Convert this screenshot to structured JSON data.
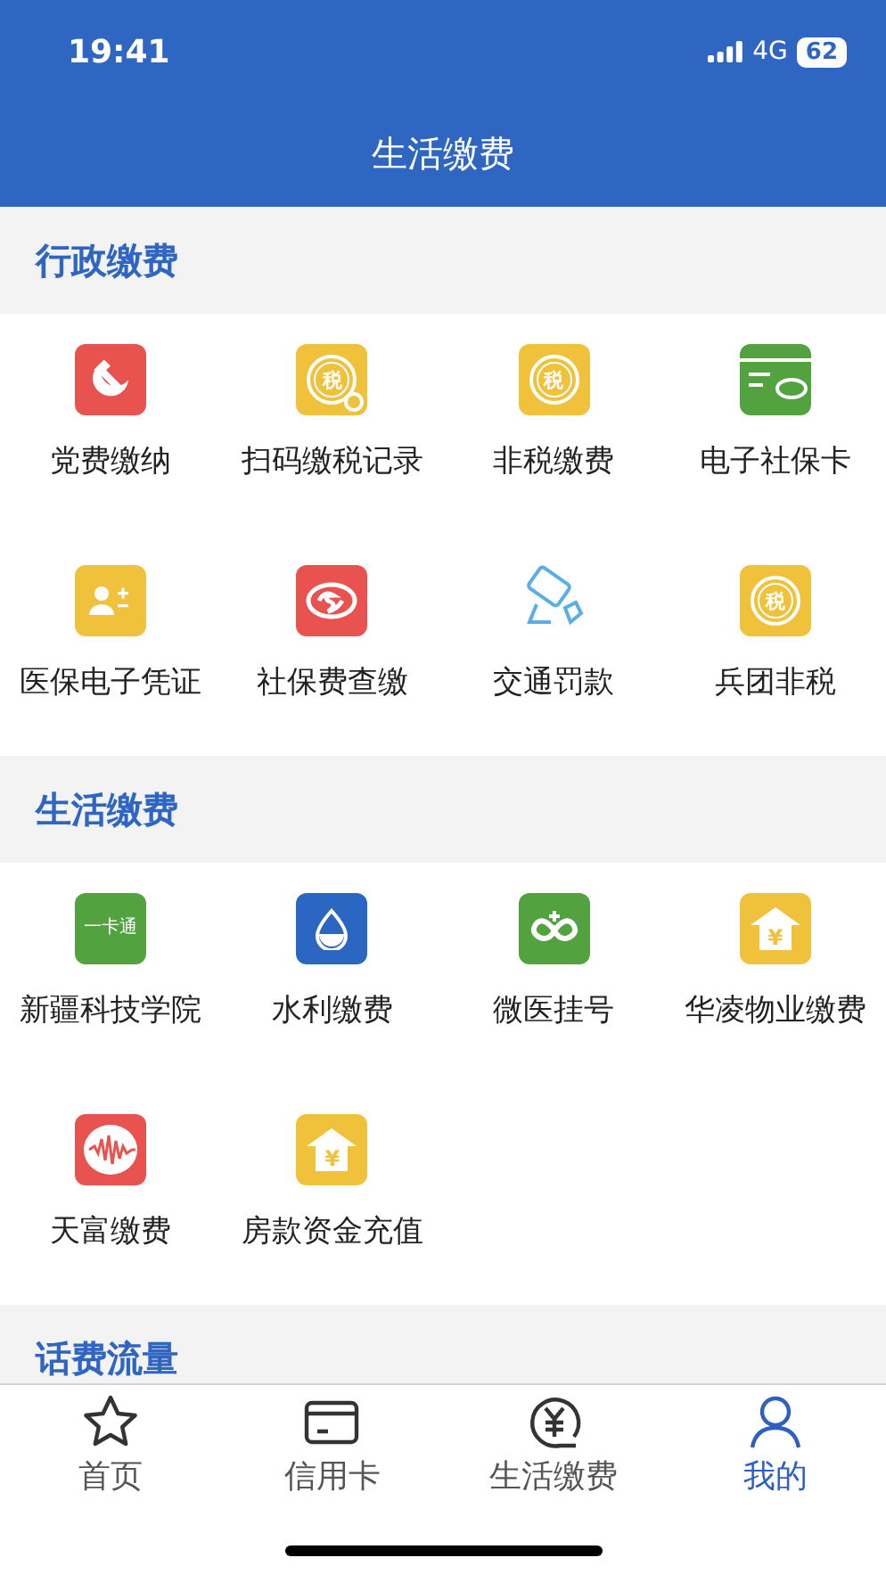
{
  "status_bar": {
    "time": "19:41",
    "network": "4G",
    "battery": "62"
  },
  "header": {
    "title": "生活缴费"
  },
  "sections": [
    {
      "title": "行政缴费",
      "items": [
        {
          "label": "党费缴纳",
          "kind": "party",
          "color": "#e8534f"
        },
        {
          "label": "扫码缴税记录",
          "kind": "tax-search",
          "color": "#f0c23b",
          "icon_text": "税"
        },
        {
          "label": "非税缴费",
          "kind": "tax",
          "color": "#f0c23b",
          "icon_text": "税"
        },
        {
          "label": "电子社保卡",
          "kind": "card",
          "color": "#52a33f"
        },
        {
          "label": "医保电子凭证",
          "kind": "person",
          "color": "#f0c23b"
        },
        {
          "label": "社保费查缴",
          "kind": "social",
          "color": "#e8534f"
        },
        {
          "label": "交通罚款",
          "kind": "camera",
          "color": "#5aaee6"
        },
        {
          "label": "兵团非税",
          "kind": "tax",
          "color": "#f0c23b",
          "icon_text": "税"
        }
      ]
    },
    {
      "title": "生活缴费",
      "items": [
        {
          "label": "新疆科技学院",
          "kind": "text",
          "color": "#52a33f",
          "icon_text": "一卡通"
        },
        {
          "label": "水利缴费",
          "kind": "drop",
          "color": "#2b66c2"
        },
        {
          "label": "微医挂号",
          "kind": "loop",
          "color": "#52a33f"
        },
        {
          "label": "华凌物业缴费",
          "kind": "house",
          "color": "#f0c23b",
          "icon_text": "¥"
        },
        {
          "label": "天富缴费",
          "kind": "wave",
          "color": "#e8534f"
        },
        {
          "label": "房款资金充值",
          "kind": "house",
          "color": "#f0c23b",
          "icon_text": "¥"
        }
      ]
    },
    {
      "title": "话费流量"
    }
  ],
  "tabs": [
    {
      "label": "首页",
      "kind": "star",
      "selected": false
    },
    {
      "label": "信用卡",
      "kind": "card",
      "selected": false
    },
    {
      "label": "生活缴费",
      "kind": "yen",
      "selected": false
    },
    {
      "label": "我的",
      "kind": "user",
      "selected": true
    }
  ]
}
